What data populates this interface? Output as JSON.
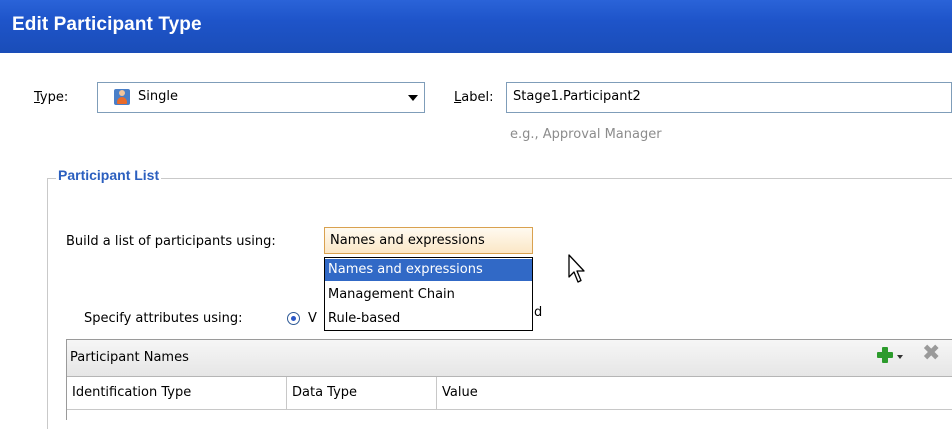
{
  "window": {
    "title": "Edit Participant Type"
  },
  "type_field": {
    "label": "Type:",
    "value": "Single",
    "icon": "user-icon"
  },
  "label_field": {
    "label": "Label:",
    "value": "Stage1.Participant2",
    "hint": "e.g., Approval Manager"
  },
  "participant_list": {
    "title": "Participant List",
    "build_label": "Build a list of participants using:",
    "build_value": "Names and expressions",
    "options": [
      "Names and expressions",
      "Management Chain",
      "Rule-based"
    ],
    "selected_option": "Names and expressions",
    "attributes_label": "Specify attributes using:",
    "attributes_radio_visible_text": "V",
    "attributes_trailing_text": "d"
  },
  "names_table": {
    "title": "Participant Names",
    "add_icon": "plus-icon",
    "delete_icon": "close-icon",
    "columns": [
      "Identification Type",
      "Data Type",
      "Value"
    ]
  },
  "colors": {
    "title_bar": "#1e54c9",
    "accent": "#2b5fbf",
    "selection": "#3169c6"
  }
}
